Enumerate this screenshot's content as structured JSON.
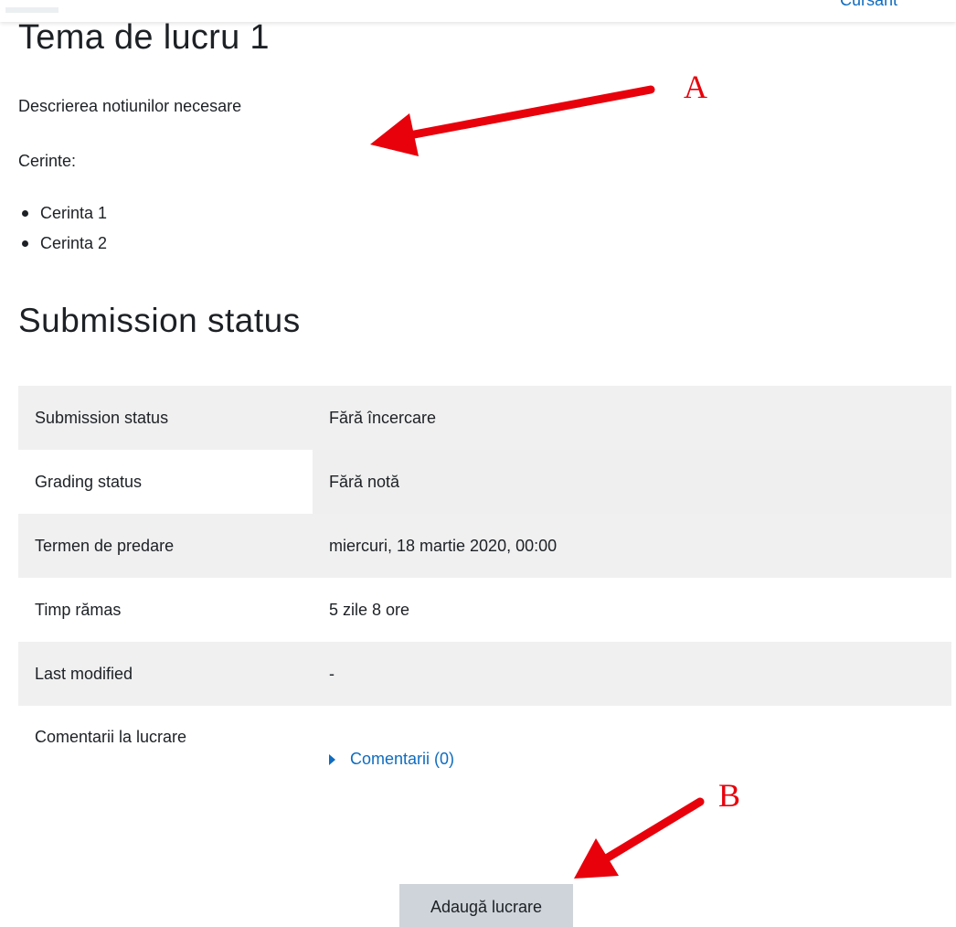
{
  "header": {
    "user_link": "Cursant"
  },
  "assignment": {
    "title": "Tema de lucru 1",
    "description": "Descrierea notiunilor necesare",
    "requirements_label": "Cerinte:",
    "requirements": [
      "Cerinta 1",
      "Cerinta 2"
    ]
  },
  "submission": {
    "heading": "Submission status",
    "rows": [
      {
        "label": "Submission status",
        "value": "Fără încercare"
      },
      {
        "label": "Grading status",
        "value": "Fără notă"
      },
      {
        "label": "Termen de predare",
        "value": "miercuri, 18 martie 2020, 00:00"
      },
      {
        "label": "Timp rămas",
        "value": "5 zile 8 ore"
      },
      {
        "label": "Last modified",
        "value": "-"
      },
      {
        "label": "Comentarii la lucrare",
        "value": "Comentarii (0)"
      }
    ],
    "add_button": "Adaugă lucrare"
  },
  "annotations": {
    "a": "A",
    "b": "B",
    "color": "#e8000b"
  },
  "colors": {
    "link": "#0f6cbf",
    "row_stripe": "#f0f0f0",
    "button_bg": "#ced4da"
  }
}
